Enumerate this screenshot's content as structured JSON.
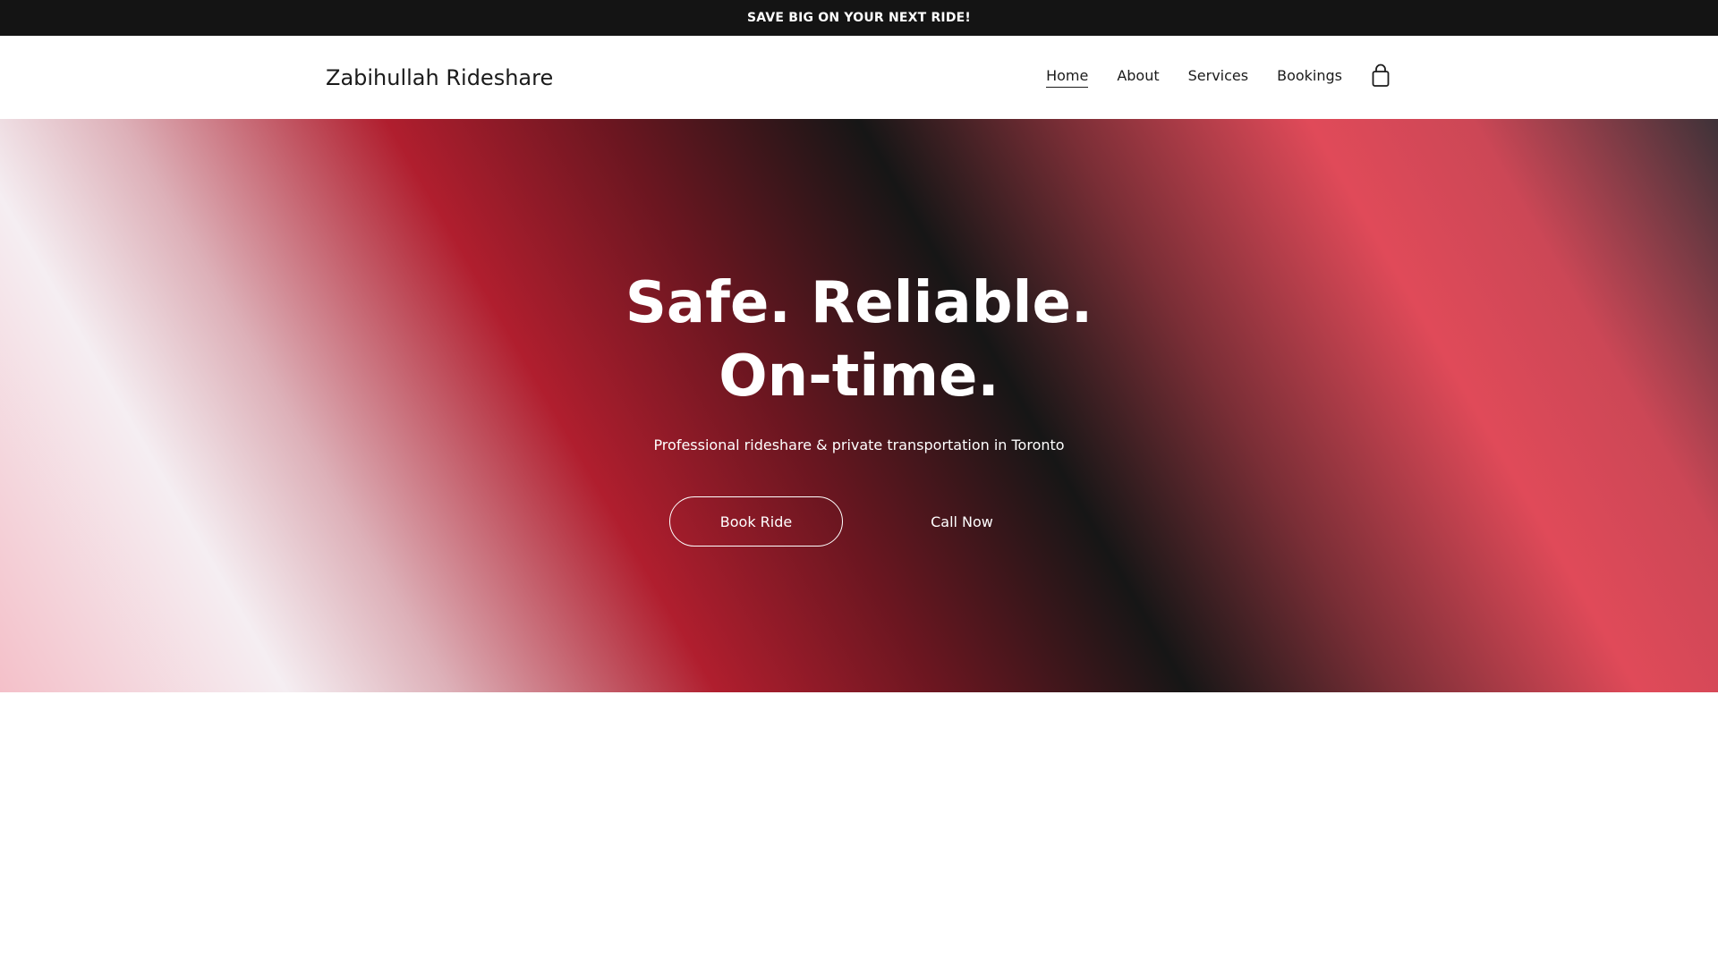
{
  "announcement": {
    "text": "SAVE BIG ON YOUR NEXT RIDE!"
  },
  "header": {
    "brand": "Zabihullah Rideshare",
    "nav": [
      {
        "label": "Home",
        "active": true
      },
      {
        "label": "About",
        "active": false
      },
      {
        "label": "Services",
        "active": false
      },
      {
        "label": "Bookings",
        "active": false
      }
    ],
    "cart_icon": "shopping-bag-icon"
  },
  "hero": {
    "title": "Safe. Reliable. On-time.",
    "subtitle": "Professional rideshare & private transportation in Toronto",
    "primary_button": "Book Ride",
    "secondary_button": "Call Now"
  },
  "colors": {
    "announcement_bg": "#141414",
    "accent_red": "#b01e2e",
    "accent_pink": "#e04a59",
    "text_dark": "#1b1b1b"
  }
}
